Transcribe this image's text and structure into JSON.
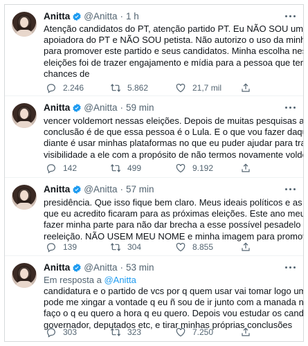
{
  "tweets": [
    {
      "name": "Anitta",
      "handle": "@Anitta",
      "time": "1 h",
      "replying": null,
      "lines": [
        "Atenção candidatos do PT, atenção partido PT. Eu NÃO SOU uma",
        "apoiadora do PT e NÃO SOU petista. Não autorizo o uso da minha imagem",
        "para promover este partido e seus candidatos. Minha escolha nessas",
        "eleições foi de trazer engajamento e mídia para a pessoa que tem maior",
        "chances de"
      ],
      "replies": "2.246",
      "retweets": "5.862",
      "likes": "21,7 mil"
    },
    {
      "name": "Anitta",
      "handle": "@Anitta",
      "time": "59 min",
      "replying": null,
      "lines": [
        "vencer voldemort nessas eleições. Depois de muitas pesquisas a",
        "conclusão é de que essa pessoa é o Lula. E o que vou fazer daqui em",
        "diante é usar minhas plataformas no que eu puder ajudar para trazer mais",
        "visibilidade a ele com a propósito de não termos novamente voldemort na"
      ],
      "replies": "142",
      "retweets": "499",
      "likes": "9.192"
    },
    {
      "name": "Anitta",
      "handle": "@Anitta",
      "time": "57 min",
      "replying": null,
      "lines": [
        "presidência. Que isso fique bem claro. Meus ideais políticos e as coisas",
        "que eu acredito ficaram para as próximas eleições. Este ano meu foco é",
        "fazer minha parte para não dar brecha a esse possível pesadelo de",
        "reeleição. NÃO USEM MEU NOME e minha imagem para promover a"
      ],
      "replies": "139",
      "retweets": "304",
      "likes": "8.855"
    },
    {
      "name": "Anitta",
      "handle": "@Anitta",
      "time": "53 min",
      "replying": {
        "prefix": "Em resposta a",
        "user": "@Anitta"
      },
      "lines": [
        "candidatura e o partido de vcs por q quem usar vai tomar logo um forão. E",
        "pode me xingar a vontade q eu ñ sou de ir junto com a manada não. Eu só",
        "faço o q eu quero a hora q eu quero. Depois vou estudar os candidatos a",
        "governador, deputados etc, e tirar minhas próprias conclusões"
      ],
      "replies": "303",
      "retweets": "323",
      "likes": "7.250"
    }
  ],
  "colors": {
    "accent": "#1d9bf0",
    "muted": "#536471",
    "text": "#0f1419"
  },
  "icons": [
    "verified-badge-icon",
    "more-icon",
    "reply-icon",
    "retweet-icon",
    "like-icon",
    "share-icon"
  ]
}
